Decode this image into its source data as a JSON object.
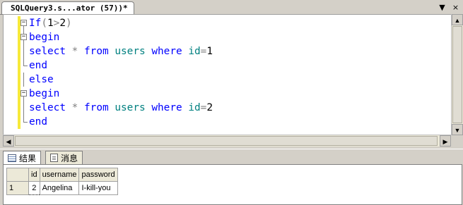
{
  "document_tab": {
    "title": "SQLQuery3.s...ator (57))*"
  },
  "window_controls": {
    "dropdown": "▼",
    "close": "×"
  },
  "editor": {
    "lines": [
      {
        "fold": "minus",
        "tokens": [
          [
            "kw",
            "If"
          ],
          [
            "op",
            "("
          ],
          [
            "num",
            "1"
          ],
          [
            "op",
            ">"
          ],
          [
            "num",
            "2"
          ],
          [
            "op",
            ")"
          ]
        ]
      },
      {
        "fold": "minus",
        "tokens": [
          [
            "kw",
            "begin"
          ]
        ]
      },
      {
        "fold": "line",
        "tokens": [
          [
            "kw",
            "select"
          ],
          [
            "bl",
            " "
          ],
          [
            "op",
            "*"
          ],
          [
            "bl",
            " "
          ],
          [
            "kw",
            "from"
          ],
          [
            "bl",
            " "
          ],
          [
            "id",
            "users"
          ],
          [
            "bl",
            " "
          ],
          [
            "kw",
            "where"
          ],
          [
            "bl",
            " "
          ],
          [
            "id",
            "id"
          ],
          [
            "op",
            "="
          ],
          [
            "num",
            "1"
          ]
        ]
      },
      {
        "fold": "end",
        "tokens": [
          [
            "kw",
            "end"
          ]
        ]
      },
      {
        "fold": "line",
        "tokens": [
          [
            "kw",
            "else"
          ]
        ]
      },
      {
        "fold": "minus",
        "tokens": [
          [
            "kw",
            "begin"
          ]
        ]
      },
      {
        "fold": "line",
        "tokens": [
          [
            "kw",
            "select"
          ],
          [
            "bl",
            " "
          ],
          [
            "op",
            "*"
          ],
          [
            "bl",
            " "
          ],
          [
            "kw",
            "from"
          ],
          [
            "bl",
            " "
          ],
          [
            "id",
            "users"
          ],
          [
            "bl",
            " "
          ],
          [
            "kw",
            "where"
          ],
          [
            "bl",
            " "
          ],
          [
            "id",
            "id"
          ],
          [
            "op",
            "="
          ],
          [
            "num",
            "2"
          ]
        ]
      },
      {
        "fold": "end",
        "tokens": [
          [
            "kw",
            "end"
          ]
        ]
      }
    ]
  },
  "results": {
    "tabs": [
      {
        "label": "结果",
        "icon": "grid-icon",
        "active": true
      },
      {
        "label": "消息",
        "icon": "messages-icon",
        "active": false
      }
    ],
    "columns": [
      "id",
      "username",
      "password"
    ],
    "rows": [
      {
        "row_number": "1",
        "cells": [
          "2",
          "Angelina",
          "I-kill-you"
        ]
      }
    ]
  },
  "colors": {
    "keyword": "#0000ff",
    "identifier": "#008080",
    "operator": "#808080",
    "change_bar": "#f6e93a"
  }
}
